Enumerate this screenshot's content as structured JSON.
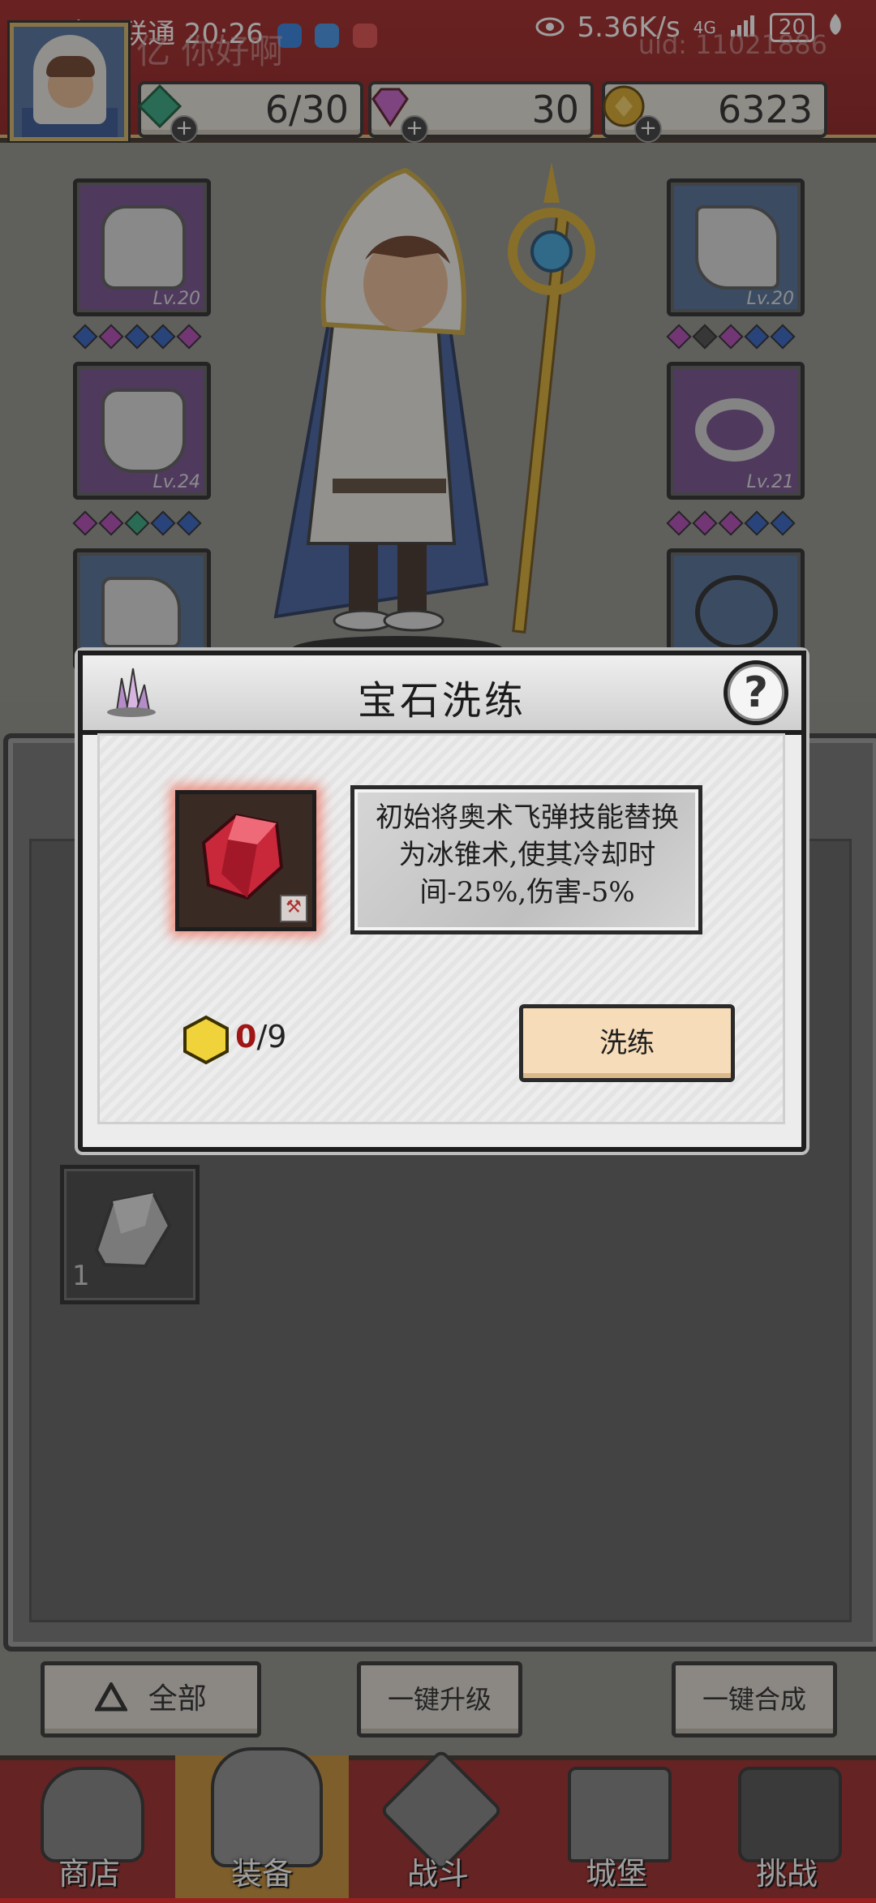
{
  "status_bar": {
    "carrier_time": "中国联通 20:26",
    "net_speed": "5.36K/s",
    "signal": "4G",
    "battery": "20"
  },
  "profile": {
    "username": "亿 你好啊",
    "uid": "uid: 11021886"
  },
  "resources": {
    "energy": "6/30",
    "diamonds": "30",
    "gold": "6323"
  },
  "equipment": {
    "left": [
      {
        "slot": "helmet",
        "level": "Lv.20"
      },
      {
        "slot": "armor",
        "level": "Lv.24"
      },
      {
        "slot": "boots",
        "level": ""
      }
    ],
    "right": [
      {
        "slot": "gloves",
        "level": "Lv.20"
      },
      {
        "slot": "ring",
        "level": "Lv.21"
      },
      {
        "slot": "necklace",
        "level": ""
      }
    ]
  },
  "dialog": {
    "title": "宝石洗练",
    "description": "初始将奥术飞弹技能替换为冰锥术,使其冷却时间-25%,伤害-5%",
    "cost_current": "0",
    "cost_total": "/9",
    "refine_label": "洗练"
  },
  "inventory": {
    "item_count": "1"
  },
  "actions": {
    "filter_label": "全部",
    "upgrade_all_label": "一键升级",
    "merge_all_label": "一键合成"
  },
  "nav": [
    {
      "label": "商店"
    },
    {
      "label": "装备"
    },
    {
      "label": "战斗"
    },
    {
      "label": "城堡"
    },
    {
      "label": "挑战"
    }
  ],
  "colors": {
    "header_red": "#9f1d1d",
    "gem_red": "#c8283a",
    "refine_button": "#f6dcb8",
    "active_tab": "#c58a2c"
  }
}
